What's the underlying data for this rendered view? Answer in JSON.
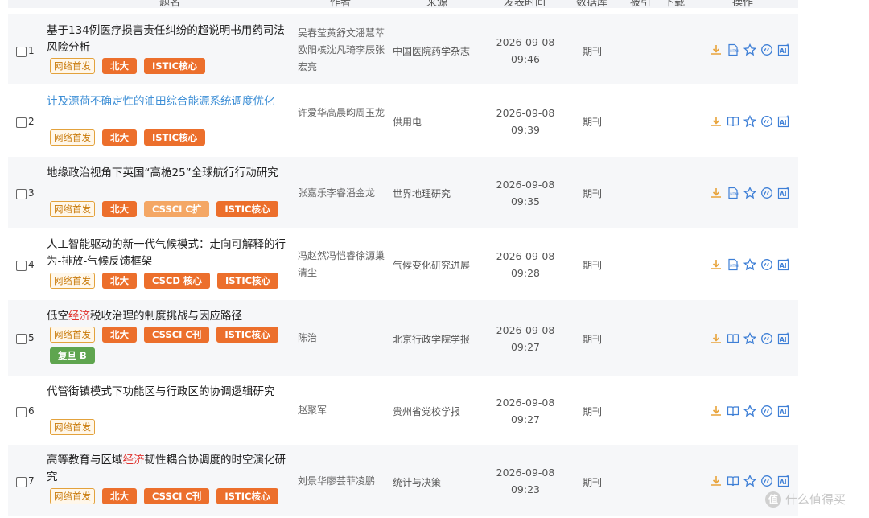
{
  "header": {
    "title": "题名",
    "authors": "作者",
    "source": "来源",
    "date": "发表时间",
    "database": "数据库",
    "cited": "被引",
    "downloads": "下载",
    "operations": "操作"
  },
  "rows": [
    {
      "num": "1",
      "title_parts": [
        "基于134例医疗损害责任纠纷的超说明书用药司法风险分析"
      ],
      "authors": "吴春莹黄舒文潘慧萃欧阳槟沈凡琦李辰张宏亮",
      "source": "中国医院药学杂志",
      "date": "2026-09-08",
      "time": "09:46",
      "database": "期刊",
      "tags": [
        "网络首发",
        "北大",
        "ISTIC核心"
      ]
    },
    {
      "num": "2",
      "title_parts": [
        "计及源荷不确定性的油田综合能源系统调度优化"
      ],
      "authors": "许爱华高晨昀周玉龙",
      "source": "供用电",
      "date": "2026-09-08",
      "time": "09:39",
      "database": "期刊",
      "tags": [
        "网络首发",
        "北大",
        "ISTIC核心"
      ]
    },
    {
      "num": "3",
      "title_parts": [
        "地缘政治视角下英国“高桅25”全球航行行动研究"
      ],
      "authors": "张嘉乐李睿潘金龙",
      "source": "世界地理研究",
      "date": "2026-09-08",
      "time": "09:35",
      "database": "期刊",
      "tags": [
        "网络首发",
        "北大",
        "CSSCI C扩",
        "ISTIC核心"
      ]
    },
    {
      "num": "4",
      "title_parts": [
        "人工智能驱动的新一代气候模式：走向可解释的行为-排放-气候反馈框架"
      ],
      "authors": "冯赵然冯恺睿徐源巢清尘",
      "source": "气候变化研究进展",
      "date": "2026-09-08",
      "time": "09:28",
      "database": "期刊",
      "tags": [
        "网络首发",
        "北大",
        "CSCD 核心",
        "ISTIC核心"
      ]
    },
    {
      "num": "5",
      "title_parts": [
        "低空",
        "经济",
        "税收治理的制度挑战与因应路径"
      ],
      "authors": "陈治",
      "source": "北京行政学院学报",
      "date": "2026-09-08",
      "time": "09:27",
      "database": "期刊",
      "tags": [
        "网络首发",
        "北大",
        "CSSCI C刊",
        "ISTIC核心",
        "复旦 B"
      ]
    },
    {
      "num": "6",
      "title_parts": [
        "代管街镇模式下功能区与行政区的协调逻辑研究"
      ],
      "authors": "赵聚军",
      "source": "贵州省党校学报",
      "date": "2026-09-08",
      "time": "09:27",
      "database": "期刊",
      "tags": [
        "网络首发"
      ]
    },
    {
      "num": "7",
      "title_parts": [
        "高等教育与区域",
        "经济",
        "韧性耦合协调度的时空演化研究"
      ],
      "authors": "刘景华廖芸菲凌鹏",
      "source": "统计与决策",
      "date": "2026-09-08",
      "time": "09:23",
      "database": "期刊",
      "tags": [
        "网络首发",
        "北大",
        "CSSCI C刊",
        "ISTIC核心"
      ]
    }
  ],
  "icons": [
    "download-icon",
    "read-icon",
    "favorite-icon",
    "cite-icon",
    "ai-icon"
  ],
  "colors": {
    "tag_orange": "#ec6f2c",
    "tag_peach": "#f4a765",
    "tag_green": "#5fa54f",
    "icon_blue": "#3e7fd6",
    "icon_download": "#e8a33a",
    "link_blue": "#3e8fd6",
    "highlight_red": "#e0332e"
  },
  "watermark": {
    "text": "什么值得买",
    "logo": "值"
  }
}
